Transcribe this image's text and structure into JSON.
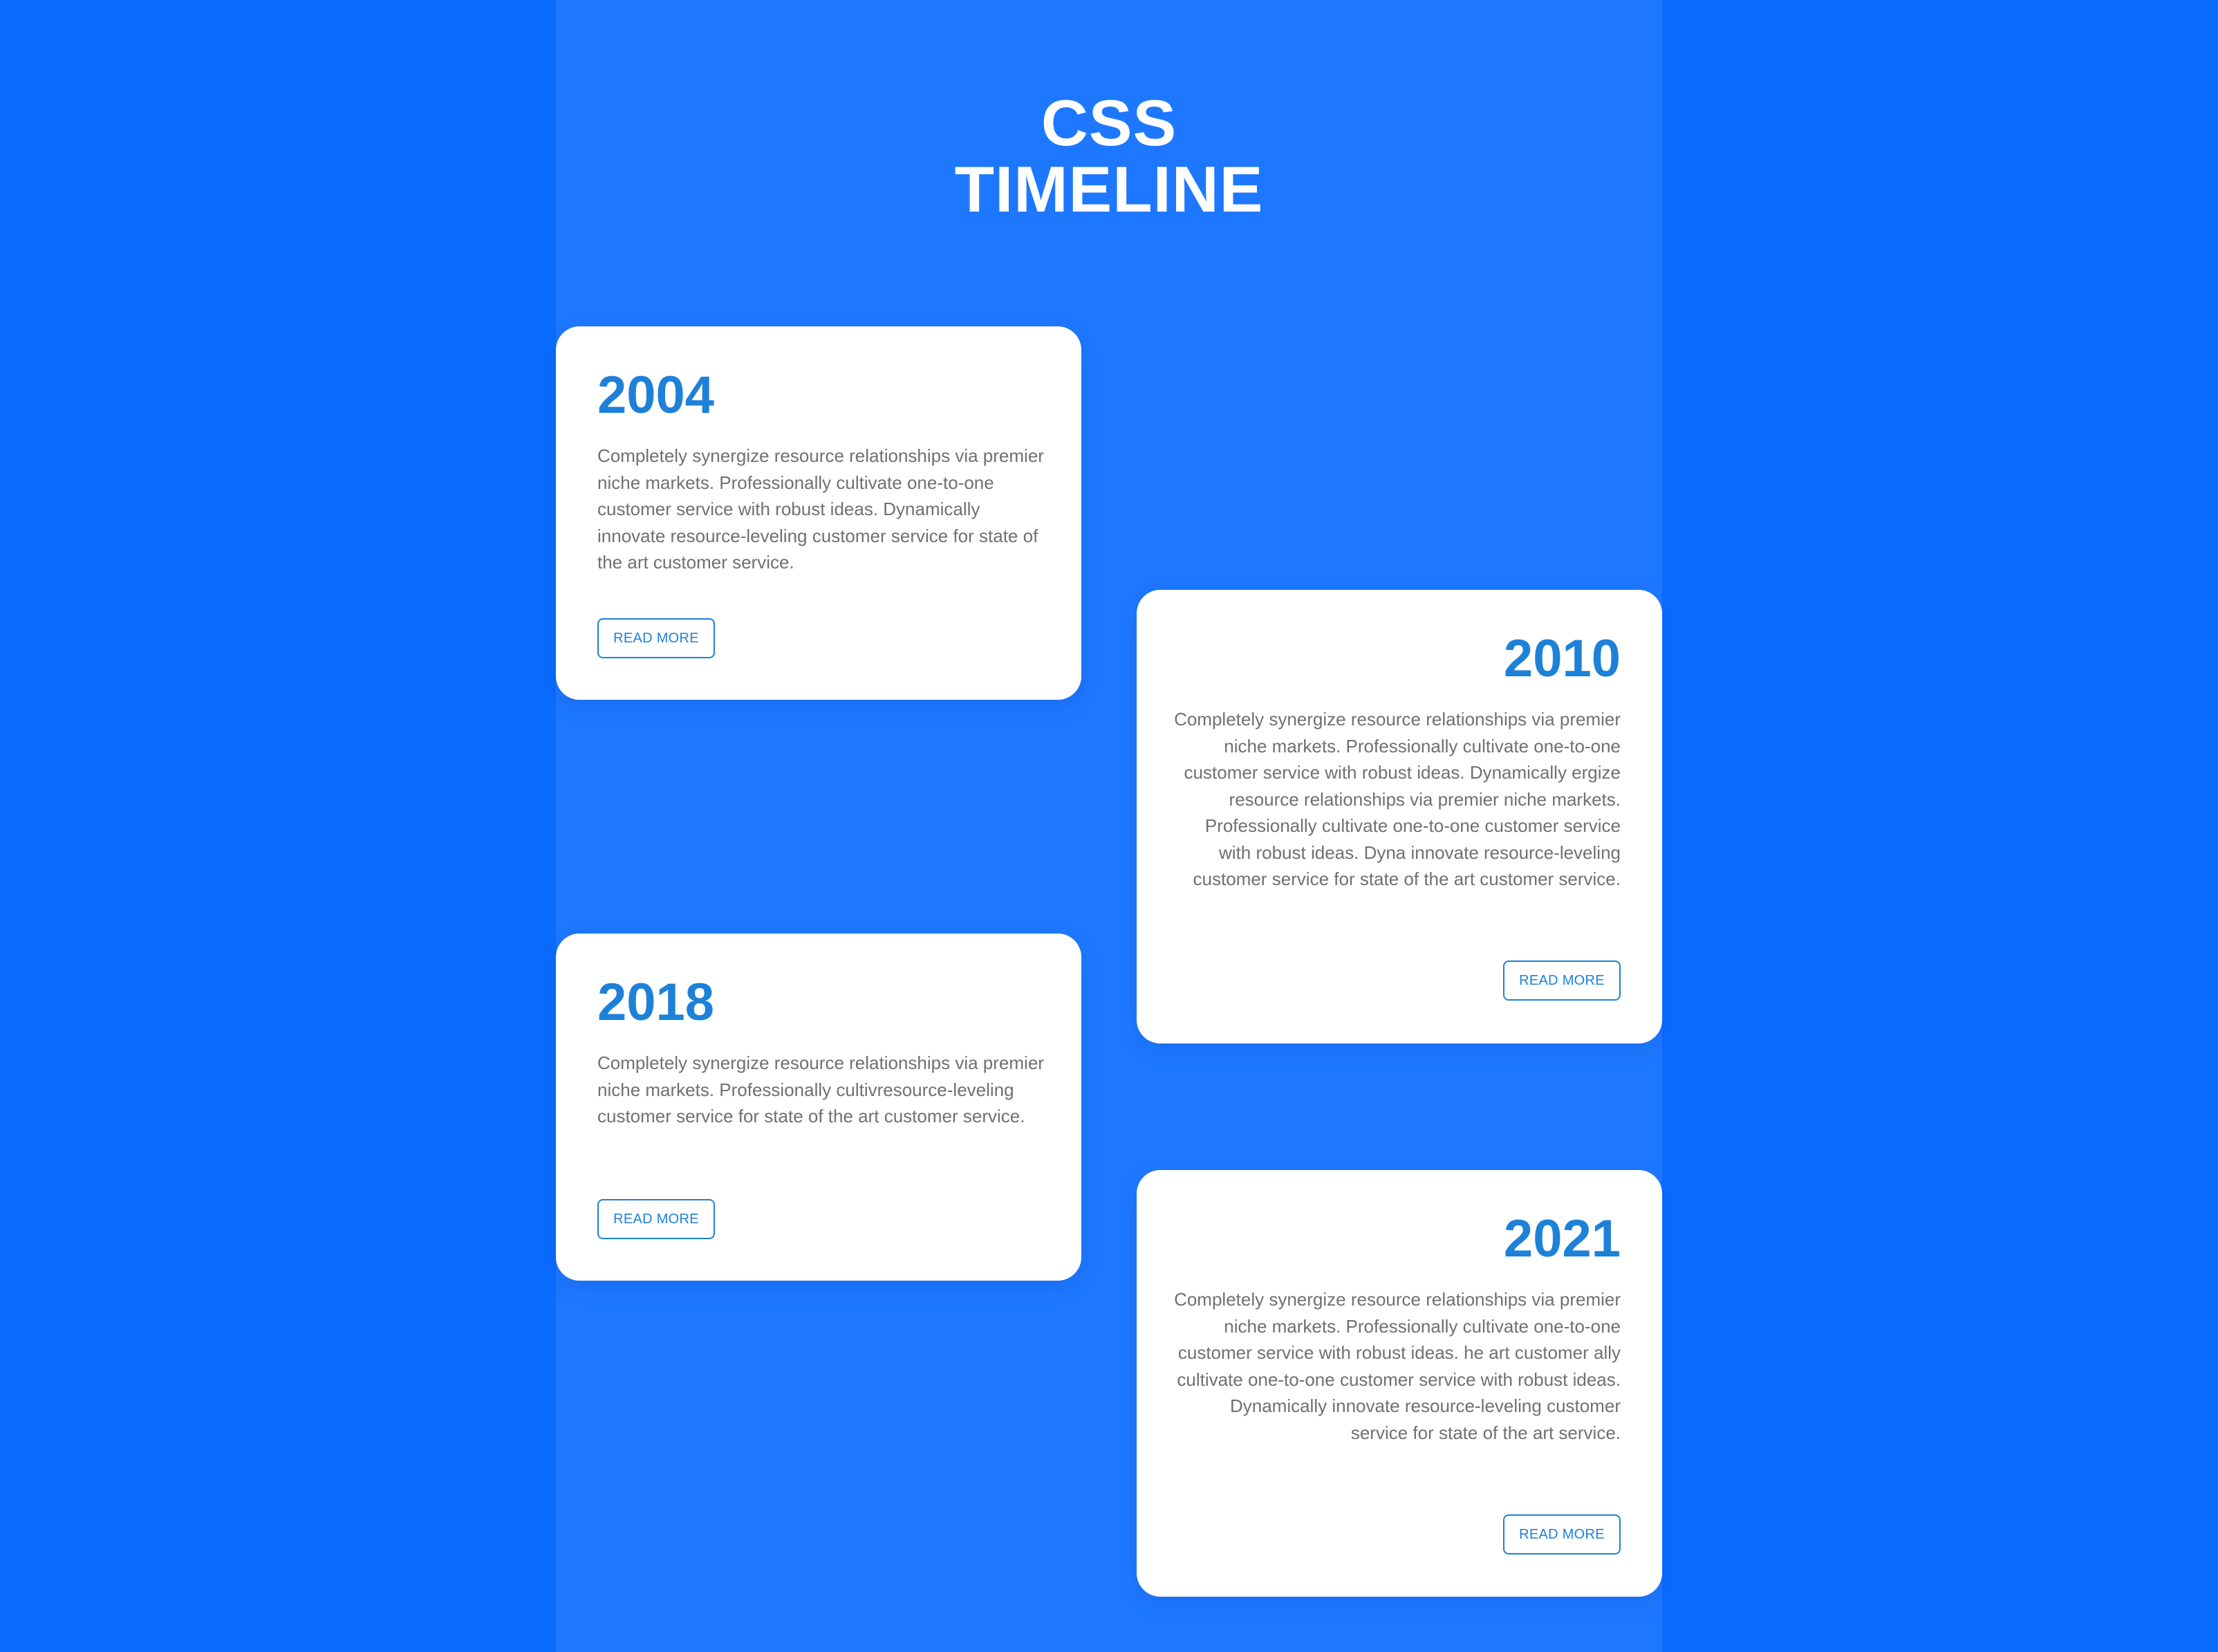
{
  "colors": {
    "page_background": "#0A6CFF",
    "center_column": "#1E78FF",
    "card_background": "#FFFFFF",
    "year_text": "#1D81D8",
    "body_text": "#707070",
    "button_accent": "#1D81D8",
    "title_text": "#FFFFFF"
  },
  "header": {
    "title_line1": "CSS",
    "title_line2": "TIMELINE"
  },
  "timeline": {
    "items": [
      {
        "year": "2004",
        "text": "Completely synergize resource relationships via premier niche markets. Professionally cultivate one-to-one customer service with robust ideas. Dynamically innovate resource-leveling customer service for state of the art customer service.",
        "button_label": "READ MORE"
      },
      {
        "year": "2010",
        "text": "Completely synergize resource relationships via premier niche markets. Professionally cultivate one-to-one customer service with robust ideas. Dynamically ergize resource relationships via premier niche markets. Professionally cultivate one-to-one customer service with robust ideas. Dyna innovate resource-leveling customer service for state of the art customer service.",
        "button_label": "READ MORE"
      },
      {
        "year": "2018",
        "text": "Completely synergize resource relationships via premier niche markets. Professionally cultivresource-leveling customer service for state of the art customer service.",
        "button_label": "READ MORE"
      },
      {
        "year": "2021",
        "text": "Completely synergize resource relationships via premier niche markets. Professionally cultivate one-to-one customer service with robust ideas. he art customer ally cultivate one-to-one customer service with robust ideas. Dynamically innovate resource-leveling customer service for state of the art service.",
        "button_label": "READ MORE"
      }
    ]
  }
}
